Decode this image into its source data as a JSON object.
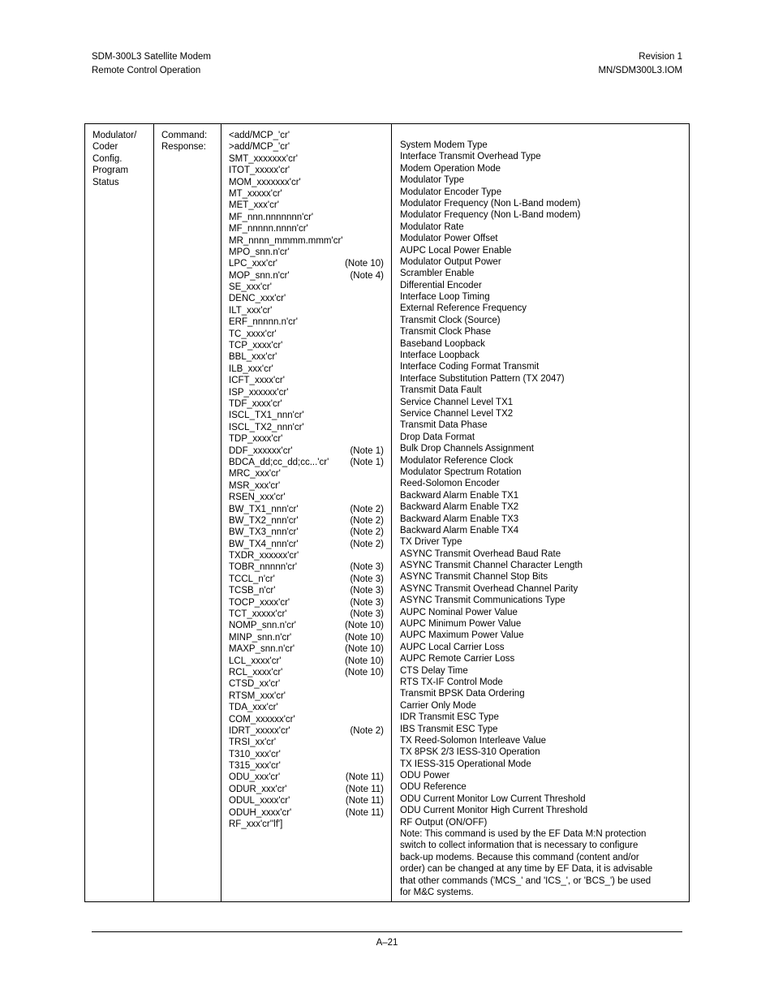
{
  "header": {
    "left_line1": "SDM-300L3 Satellite Modem",
    "left_line2": "Remote Control Operation",
    "right_line1": "Revision 1",
    "right_line2": "MN/SDM300L3.IOM"
  },
  "footer": {
    "page_number": "A–21"
  },
  "table": {
    "label_lines": [
      "Modulator/",
      "Coder",
      "Config.",
      "Program",
      "Status"
    ],
    "kind_lines": [
      "Command:",
      "Response:"
    ],
    "commands": [
      {
        "text": "<add/MCP_'cr'",
        "note": ""
      },
      {
        "text": ">add/MCP_'cr'",
        "note": ""
      },
      {
        "text": "SMT_xxxxxxx'cr'",
        "note": ""
      },
      {
        "text": "ITOT_xxxxx'cr'",
        "note": ""
      },
      {
        "text": "MOM_xxxxxxx'cr'",
        "note": ""
      },
      {
        "text": "MT_xxxxx'cr'",
        "note": ""
      },
      {
        "text": "MET_xxx'cr'",
        "note": ""
      },
      {
        "text": "MF_nnn.nnnnnnn'cr'",
        "note": ""
      },
      {
        "text": "MF_nnnnn.nnnn'cr'",
        "note": ""
      },
      {
        "text": "MR_nnnn_mmmm.mmm'cr'",
        "note": ""
      },
      {
        "text": "MPO_snn.n'cr'",
        "note": ""
      },
      {
        "text": "LPC_xxx'cr'",
        "note": "(Note 10)"
      },
      {
        "text": "MOP_snn.n'cr'",
        "note": "(Note 4)"
      },
      {
        "text": "SE_xxx'cr'",
        "note": ""
      },
      {
        "text": "DENC_xxx'cr'",
        "note": ""
      },
      {
        "text": "ILT_xxx'cr'",
        "note": ""
      },
      {
        "text": "ERF_nnnnn.n'cr'",
        "note": ""
      },
      {
        "text": "TC_xxxx'cr'",
        "note": ""
      },
      {
        "text": "TCP_xxxx'cr'",
        "note": ""
      },
      {
        "text": "BBL_xxx'cr'",
        "note": ""
      },
      {
        "text": "ILB_xxx'cr'",
        "note": ""
      },
      {
        "text": "ICFT_xxxx'cr'",
        "note": ""
      },
      {
        "text": "ISP_xxxxxx'cr'",
        "note": ""
      },
      {
        "text": "TDF_xxxx'cr'",
        "note": ""
      },
      {
        "text": "ISCL_TX1_nnn'cr'",
        "note": ""
      },
      {
        "text": "ISCL_TX2_nnn'cr'",
        "note": ""
      },
      {
        "text": "TDP_xxxx'cr'",
        "note": ""
      },
      {
        "text": "DDF_xxxxxx'cr'",
        "note": "(Note 1)"
      },
      {
        "text": "BDCA_dd;cc_dd;cc...'cr'",
        "note": "(Note 1)"
      },
      {
        "text": "MRC_xxx'cr'",
        "note": ""
      },
      {
        "text": "MSR_xxx'cr'",
        "note": ""
      },
      {
        "text": "RSEN_xxx'cr'",
        "note": ""
      },
      {
        "text": "BW_TX1_nnn'cr'",
        "note": "(Note 2)"
      },
      {
        "text": "BW_TX2_nnn'cr'",
        "note": "(Note 2)"
      },
      {
        "text": "BW_TX3_nnn'cr'",
        "note": "(Note 2)"
      },
      {
        "text": "BW_TX4_nnn'cr'",
        "note": "(Note 2)"
      },
      {
        "text": "TXDR_xxxxxx'cr'",
        "note": ""
      },
      {
        "text": "TOBR_nnnnn'cr'",
        "note": "(Note 3)"
      },
      {
        "text": "TCCL_n'cr'",
        "note": "(Note 3)"
      },
      {
        "text": "TCSB_n'cr'",
        "note": "(Note 3)"
      },
      {
        "text": "TOCP_xxxx'cr'",
        "note": "(Note 3)"
      },
      {
        "text": "TCT_xxxxx'cr'",
        "note": "(Note 3)"
      },
      {
        "text": "NOMP_snn.n'cr'",
        "note": "(Note 10)"
      },
      {
        "text": "MINP_snn.n'cr'",
        "note": "(Note 10)"
      },
      {
        "text": "MAXP_snn.n'cr'",
        "note": "(Note 10)"
      },
      {
        "text": "LCL_xxxx'cr'",
        "note": "(Note 10)"
      },
      {
        "text": "RCL_xxxx'cr'",
        "note": "(Note 10)"
      },
      {
        "text": "CTSD_xx'cr'",
        "note": ""
      },
      {
        "text": "RTSM_xxx'cr'",
        "note": ""
      },
      {
        "text": "TDA_xxx'cr'",
        "note": ""
      },
      {
        "text": "COM_xxxxxx'cr'",
        "note": ""
      },
      {
        "text": "IDRT_xxxxx'cr'",
        "note": "(Note 2)"
      },
      {
        "text": "TRSI_xx'cr'",
        "note": ""
      },
      {
        "text": "T310_xxx'cr'",
        "note": ""
      },
      {
        "text": "T315_xxx'cr'",
        "note": ""
      },
      {
        "text": "ODU_xxx'cr'",
        "note": "(Note 11)"
      },
      {
        "text": "ODUR_xxx'cr'",
        "note": "(Note 11)"
      },
      {
        "text": "ODUL_xxxx'cr'",
        "note": "(Note 11)"
      },
      {
        "text": "ODUH_xxxx'cr'",
        "note": "(Note 11)"
      },
      {
        "text": "RF_xxx'cr''lf']",
        "note": ""
      }
    ],
    "descriptions": [
      "System Modem Type",
      "Interface Transmit Overhead Type",
      "Modem Operation Mode",
      "Modulator Type",
      "Modulator Encoder Type",
      "Modulator Frequency (Non L-Band modem)",
      "Modulator Frequency (Non L-Band modem)",
      "Modulator Rate",
      "Modulator Power Offset",
      "AUPC Local Power Enable",
      "Modulator Output Power",
      "Scrambler Enable",
      "Differential Encoder",
      "Interface Loop Timing",
      "External Reference Frequency",
      "Transmit Clock (Source)",
      "Transmit Clock Phase",
      "Baseband Loopback",
      "Interface Loopback",
      "Interface Coding Format Transmit",
      "Interface Substitution Pattern (TX 2047)",
      "Transmit Data Fault",
      "Service Channel Level TX1",
      "Service Channel Level TX2",
      "Transmit Data Phase",
      "Drop Data Format",
      "Bulk Drop Channels Assignment",
      "Modulator Reference Clock",
      "Modulator Spectrum Rotation",
      "Reed-Solomon Encoder",
      "Backward Alarm Enable TX1",
      "Backward Alarm Enable TX2",
      "Backward Alarm Enable TX3",
      "Backward Alarm Enable TX4",
      "TX Driver Type",
      "ASYNC Transmit Overhead Baud Rate",
      "ASYNC Transmit Channel Character Length",
      "ASYNC Transmit Channel Stop Bits",
      "ASYNC Transmit Overhead Channel Parity",
      "ASYNC Transmit Communications Type",
      "AUPC Nominal Power Value",
      "AUPC Minimum Power Value",
      "AUPC Maximum Power Value",
      "AUPC Local Carrier Loss",
      "AUPC Remote Carrier Loss",
      "CTS Delay Time",
      "RTS TX-IF Control Mode",
      "Transmit BPSK Data Ordering",
      "Carrier Only Mode",
      "IDR Transmit ESC Type",
      "IBS Transmit ESC Type",
      " TX Reed-Solomon Interleave Value",
      "TX 8PSK 2/3 IESS-310 Operation",
      "TX IESS-315 Operational Mode",
      "ODU Power",
      "ODU Reference",
      "ODU Current  Monitor Low Current Threshold",
      "ODU Current  Monitor High Current  Threshold",
      "RF Output (ON/OFF)"
    ],
    "note_paragraph_lines": [
      "Note: This command is used by the EF Data M:N protection",
      "switch to collect information that is necessary to configure",
      "back-up modems. Because this command (content and/or",
      "order) can be changed at any time by EF Data, it is advisable",
      "that other commands ('MCS_' and 'ICS_', or 'BCS_') be used",
      "for M&C systems."
    ]
  }
}
